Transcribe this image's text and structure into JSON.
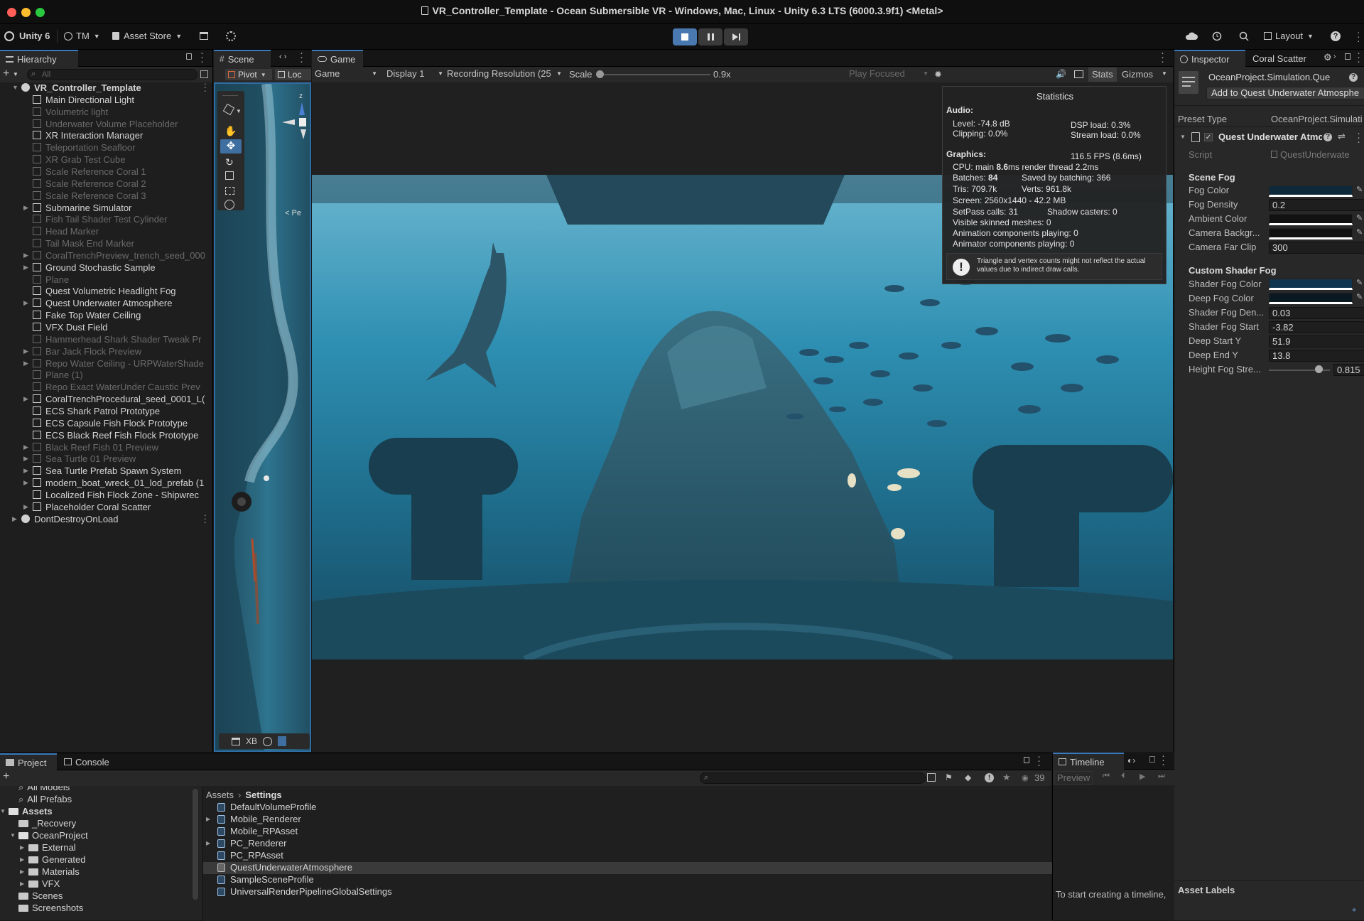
{
  "window": {
    "title": "VR_Controller_Template - Ocean Submersible VR - Windows, Mac, Linux - Unity 6.3 LTS (6000.3.9f1) <Metal>"
  },
  "toolbar": {
    "unity_label": "Unity 6",
    "account": "TM",
    "asset_store": "Asset Store",
    "layout": "Layout"
  },
  "hierarchy": {
    "tab": "Hierarchy",
    "search_placeholder": "All",
    "items": [
      {
        "label": "VR_Controller_Template",
        "depth": 0,
        "arrow": "down",
        "dim": false,
        "bold": true,
        "scene": true
      },
      {
        "label": "Main Directional Light",
        "depth": 1,
        "arrow": "",
        "dim": false
      },
      {
        "label": "Volumetric light",
        "depth": 1,
        "arrow": "",
        "dim": true
      },
      {
        "label": "Underwater Volume Placeholder",
        "depth": 1,
        "arrow": "",
        "dim": true
      },
      {
        "label": "XR Interaction Manager",
        "depth": 1,
        "arrow": "",
        "dim": false
      },
      {
        "label": "Teleportation Seafloor",
        "depth": 1,
        "arrow": "",
        "dim": true
      },
      {
        "label": "XR Grab Test Cube",
        "depth": 1,
        "arrow": "",
        "dim": true
      },
      {
        "label": "Scale Reference Coral 1",
        "depth": 1,
        "arrow": "",
        "dim": true
      },
      {
        "label": "Scale Reference Coral 2",
        "depth": 1,
        "arrow": "",
        "dim": true
      },
      {
        "label": "Scale Reference Coral 3",
        "depth": 1,
        "arrow": "",
        "dim": true
      },
      {
        "label": "Submarine Simulator",
        "depth": 1,
        "arrow": "right",
        "dim": false
      },
      {
        "label": "Fish Tail Shader Test Cylinder",
        "depth": 1,
        "arrow": "",
        "dim": true
      },
      {
        "label": "Head Marker",
        "depth": 1,
        "arrow": "",
        "dim": true
      },
      {
        "label": "Tail Mask End Marker",
        "depth": 1,
        "arrow": "",
        "dim": true
      },
      {
        "label": "CoralTrenchPreview_trench_seed_000",
        "depth": 1,
        "arrow": "right",
        "dim": true
      },
      {
        "label": "Ground Stochastic Sample",
        "depth": 1,
        "arrow": "right",
        "dim": false
      },
      {
        "label": "Plane",
        "depth": 1,
        "arrow": "",
        "dim": true
      },
      {
        "label": "Quest Volumetric Headlight Fog",
        "depth": 1,
        "arrow": "",
        "dim": false
      },
      {
        "label": "Quest Underwater Atmosphere",
        "depth": 1,
        "arrow": "right",
        "dim": false
      },
      {
        "label": "Fake Top Water Ceiling",
        "depth": 1,
        "arrow": "",
        "dim": false
      },
      {
        "label": "VFX Dust Field",
        "depth": 1,
        "arrow": "",
        "dim": false
      },
      {
        "label": "Hammerhead Shark Shader Tweak Pr",
        "depth": 1,
        "arrow": "",
        "dim": true
      },
      {
        "label": "Bar Jack Flock Preview",
        "depth": 1,
        "arrow": "right",
        "dim": true
      },
      {
        "label": "Repo Water Ceiling - URPWaterShade",
        "depth": 1,
        "arrow": "right",
        "dim": true
      },
      {
        "label": "Plane (1)",
        "depth": 1,
        "arrow": "",
        "dim": true
      },
      {
        "label": "Repo Exact WaterUnder Caustic Prev",
        "depth": 1,
        "arrow": "",
        "dim": true
      },
      {
        "label": "CoralTrenchProcedural_seed_0001_L(",
        "depth": 1,
        "arrow": "right",
        "dim": false
      },
      {
        "label": "ECS Shark Patrol Prototype",
        "depth": 1,
        "arrow": "",
        "dim": false
      },
      {
        "label": "ECS Capsule Fish Flock Prototype",
        "depth": 1,
        "arrow": "",
        "dim": false
      },
      {
        "label": "ECS Black Reef Fish Flock Prototype",
        "depth": 1,
        "arrow": "",
        "dim": false
      },
      {
        "label": "Black Reef Fish 01 Preview",
        "depth": 1,
        "arrow": "right",
        "dim": true
      },
      {
        "label": "Sea Turtle 01 Preview",
        "depth": 1,
        "arrow": "right",
        "dim": true
      },
      {
        "label": "Sea Turtle Prefab Spawn System",
        "depth": 1,
        "arrow": "right",
        "dim": false
      },
      {
        "label": "modern_boat_wreck_01_lod_prefab (1",
        "depth": 1,
        "arrow": "right",
        "dim": false
      },
      {
        "label": "Localized Fish Flock Zone - Shipwrec",
        "depth": 1,
        "arrow": "",
        "dim": false
      },
      {
        "label": "Placeholder Coral Scatter",
        "depth": 1,
        "arrow": "right",
        "dim": false
      },
      {
        "label": "DontDestroyOnLoad",
        "depth": 0,
        "arrow": "right",
        "dim": false,
        "bold": false,
        "scene": true
      }
    ]
  },
  "scene": {
    "tab": "Scene",
    "pivot": "Pivot",
    "local": "Loc",
    "persp": "< Pe",
    "axis_z": "z",
    "xb": "XB"
  },
  "game": {
    "tab": "Game",
    "view_mode": "Game",
    "display": "Display 1",
    "resolution": "Recording Resolution (25",
    "scale_label": "Scale",
    "scale_value": "0.9x",
    "play_focused": "Play Focused",
    "stats": "Stats",
    "gizmos": "Gizmos"
  },
  "statistics": {
    "title": "Statistics",
    "audio_header": "Audio:",
    "level": "Level: -74.8 dB",
    "clipping": "Clipping: 0.0%",
    "dsp": "DSP load: 0.3%",
    "stream": "Stream load: 0.0%",
    "graphics_header": "Graphics:",
    "fps": "116.5 FPS (8.6ms)",
    "cpu_prefix": "CPU: main ",
    "cpu_main": "8.6",
    "cpu_suffix": "ms  render thread 2.2ms",
    "batches_prefix": "Batches: ",
    "batches": "84",
    "saved": "Saved by batching: 366",
    "tris": "Tris: 709.7k",
    "verts": "Verts: 961.8k",
    "screen": "Screen: 2560x1440 - 42.2 MB",
    "setpass": "SetPass calls: 31",
    "shadow": "Shadow casters: 0",
    "skinned": "Visible skinned meshes: 0",
    "anim": "Animation components playing: 0",
    "animator": "Animator components playing: 0",
    "warning": "Triangle and vertex counts might not reflect the actual values due to indirect draw calls."
  },
  "inspector": {
    "tab": "Inspector",
    "tab2": "Coral Scatter",
    "object_name": "OceanProject.Simulation.Que",
    "add_button": "Add to Quest Underwater Atmosphe",
    "preset_type_label": "Preset Type",
    "preset_type_value": "OceanProject.Simulati",
    "component": "Quest Underwater Atmc",
    "script_label": "Script",
    "script_value": "QuestUnderwate",
    "section_scene_fog": "Scene Fog",
    "fog_color_label": "Fog Color",
    "fog_density_label": "Fog Density",
    "fog_density": "0.2",
    "ambient_color_label": "Ambient Color",
    "camera_bg_label": "Camera Backgr...",
    "camera_far_label": "Camera Far Clip",
    "camera_far": "300",
    "section_custom": "Custom Shader Fog",
    "shader_fog_color_label": "Shader Fog Color",
    "deep_fog_color_label": "Deep Fog Color",
    "shader_fog_den_label": "Shader Fog Den...",
    "shader_fog_den": "0.03",
    "shader_fog_start_label": "Shader Fog Start",
    "shader_fog_start": "-3.82",
    "deep_start_label": "Deep Start Y",
    "deep_start": "51.9",
    "deep_end_label": "Deep End Y",
    "deep_end": "13.8",
    "height_fog_label": "Height Fog Stre...",
    "height_fog": "0.815",
    "height_fog_fraction": 0.815,
    "asset_labels": "Asset Labels"
  },
  "project": {
    "tab": "Project",
    "tab2": "Console",
    "count": "39",
    "breadcrumb_root": "Assets",
    "breadcrumb_current": "Settings",
    "tree": [
      {
        "label": "All Models",
        "indent": 1,
        "kind": "search",
        "arrow": ""
      },
      {
        "label": "All Prefabs",
        "indent": 1,
        "kind": "search",
        "arrow": ""
      },
      {
        "label": "Assets",
        "indent": 0,
        "kind": "folder",
        "arrow": "down",
        "bold": true
      },
      {
        "label": "_Recovery",
        "indent": 1,
        "kind": "folder",
        "arrow": ""
      },
      {
        "label": "OceanProject",
        "indent": 1,
        "kind": "folder",
        "arrow": "down"
      },
      {
        "label": "External",
        "indent": 2,
        "kind": "folder",
        "arrow": "right"
      },
      {
        "label": "Generated",
        "indent": 2,
        "kind": "folder",
        "arrow": "right"
      },
      {
        "label": "Materials",
        "indent": 2,
        "kind": "folder",
        "arrow": "right"
      },
      {
        "label": "VFX",
        "indent": 2,
        "kind": "folder",
        "arrow": "right"
      },
      {
        "label": "Scenes",
        "indent": 1,
        "kind": "folder",
        "arrow": ""
      },
      {
        "label": "Screenshots",
        "indent": 1,
        "kind": "folder",
        "arrow": ""
      }
    ],
    "files": [
      {
        "label": "DefaultVolumeProfile",
        "arrow": "",
        "selected": false
      },
      {
        "label": "Mobile_Renderer",
        "arrow": "right",
        "selected": false
      },
      {
        "label": "Mobile_RPAsset",
        "arrow": "",
        "selected": false
      },
      {
        "label": "PC_Renderer",
        "arrow": "right",
        "selected": false
      },
      {
        "label": "PC_RPAsset",
        "arrow": "",
        "selected": false
      },
      {
        "label": "QuestUnderwaterAtmosphere",
        "arrow": "",
        "selected": true
      },
      {
        "label": "SampleSceneProfile",
        "arrow": "",
        "selected": false
      },
      {
        "label": "UniversalRenderPipelineGlobalSettings",
        "arrow": "",
        "selected": false
      }
    ]
  },
  "timeline": {
    "tab": "Timeline",
    "preview": "Preview",
    "hint": "To start creating a timeline,"
  },
  "colors": {
    "accent": "#3a79bb",
    "bg": "#191919",
    "panel": "#282828",
    "selected": "#2c5d87"
  }
}
